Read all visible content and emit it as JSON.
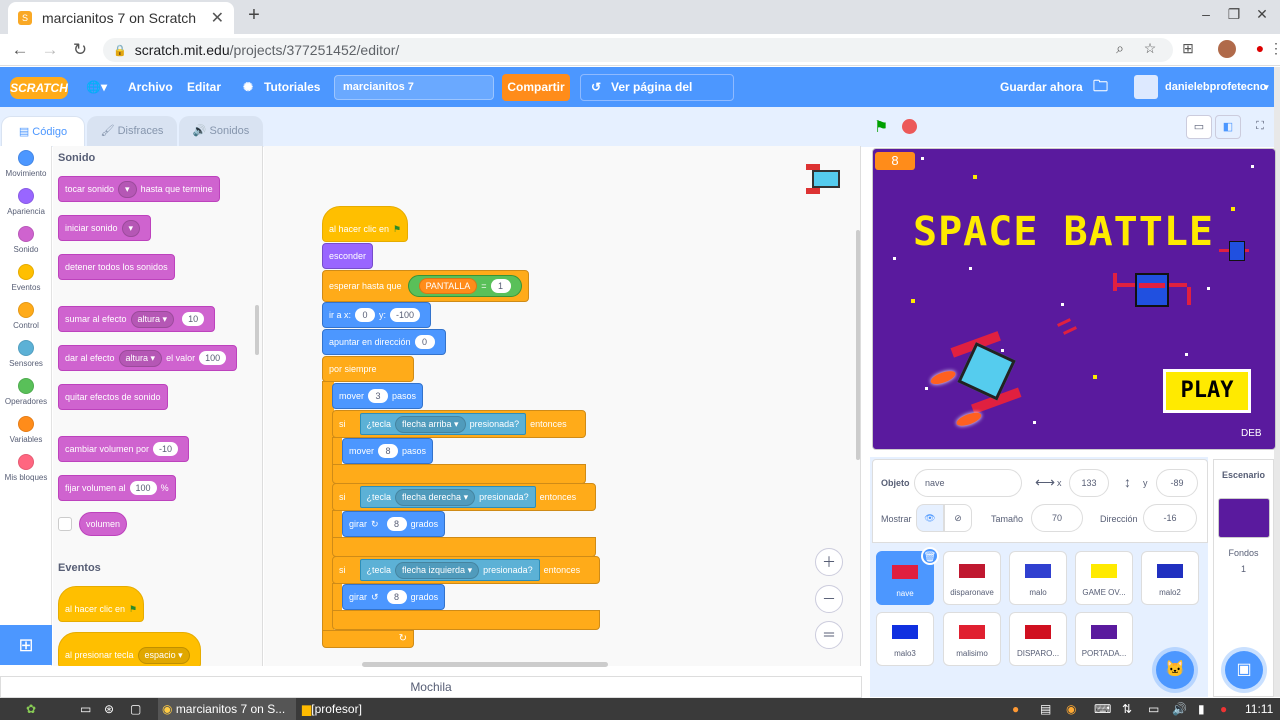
{
  "browser": {
    "tab_title": "marcianitos 7 on Scratch",
    "url_host": "scratch.mit.edu",
    "url_path": "/projects/377251452/editor/"
  },
  "menu": {
    "logo": "SCRATCH",
    "file": "Archivo",
    "edit": "Editar",
    "tutorials": "Tutoriales",
    "project_name": "marcianitos 7",
    "share": "Compartir",
    "project_page": "Ver página del proyecto",
    "save_now": "Guardar ahora",
    "username": "danielebprofetecno"
  },
  "tabs": {
    "code": "Código",
    "costumes": "Disfraces",
    "sounds": "Sonidos"
  },
  "categories": [
    {
      "label": "Movimiento",
      "color": "#4c97ff"
    },
    {
      "label": "Apariencia",
      "color": "#9966ff"
    },
    {
      "label": "Sonido",
      "color": "#cf63cf"
    },
    {
      "label": "Eventos",
      "color": "#ffbf00"
    },
    {
      "label": "Control",
      "color": "#ffab19"
    },
    {
      "label": "Sensores",
      "color": "#5cb1d6"
    },
    {
      "label": "Operadores",
      "color": "#59c059"
    },
    {
      "label": "Variables",
      "color": "#ff8c1a"
    },
    {
      "label": "Mis bloques",
      "color": "#ff6680"
    }
  ],
  "palette": {
    "sound_heading": "Sonido",
    "play_until_done": "tocar sonido",
    "until_done_suffix": "hasta que termine",
    "start_sound": "iniciar sonido",
    "stop_all": "detener todos los sonidos",
    "change_effect": "sumar al efecto",
    "effect_pitch": "altura",
    "change_effect_val": "10",
    "set_effect": "dar al efecto",
    "set_effect_dd": "altura",
    "set_effect_mid": "el valor",
    "set_effect_val": "100",
    "clear_effects": "quitar efectos de sonido",
    "change_volume": "cambiar volumen por",
    "change_volume_val": "-10",
    "set_volume": "fijar volumen al",
    "set_volume_val": "100",
    "set_volume_unit": "%",
    "volume_reporter": "volumen",
    "events_heading": "Eventos",
    "when_flag": "al hacer clic en",
    "when_key": "al presionar tecla",
    "when_key_dd": "espacio"
  },
  "script": {
    "when_flag": "al hacer clic en",
    "hide": "esconder",
    "wait_until": "esperar hasta que",
    "var_pantalla": "PANTALLA",
    "eq": "=",
    "eq_val": "1",
    "goto": "ir a x:",
    "goto_x": "0",
    "goto_y_label": "y:",
    "goto_y": "-100",
    "point_dir": "apuntar en dirección",
    "point_dir_val": "0",
    "forever": "por siempre",
    "move1": "mover",
    "move1_val": "3",
    "steps": "pasos",
    "if1": "si",
    "key_label": "¿tecla",
    "key1": "flecha arriba",
    "pressed": "presionada?",
    "then": "entonces",
    "move2": "mover",
    "move2_val": "8",
    "if2": "si",
    "key2": "flecha derecha",
    "turn_right": "girar",
    "turn_right_val": "8",
    "degrees": "grados",
    "if3": "si",
    "key3": "flecha izquierda",
    "turn_left": "girar",
    "turn_left_val": "8"
  },
  "backpack": "Mochila",
  "stage": {
    "score": "8",
    "title": "SPACE BATTLE",
    "play": "PLAY",
    "credit": "DEB"
  },
  "sprite_info": {
    "sprite_label": "Objeto",
    "sprite_name": "nave",
    "x_label": "x",
    "x": "133",
    "y_label": "y",
    "y": "-89",
    "show_label": "Mostrar",
    "size_label": "Tamaño",
    "size": "70",
    "direction_label": "Dirección",
    "direction": "-16"
  },
  "sprites": [
    {
      "name": "nave",
      "color": "#e02040"
    },
    {
      "name": "disparonave",
      "color": "#c01830"
    },
    {
      "name": "malo",
      "color": "#3040d0"
    },
    {
      "name": "GAME OV...",
      "color": "#ffea00"
    },
    {
      "name": "malo2",
      "color": "#2030c0"
    },
    {
      "name": "malo3",
      "color": "#1030e0"
    },
    {
      "name": "malisimo",
      "color": "#e02030"
    },
    {
      "name": "DISPARO...",
      "color": "#d01020"
    },
    {
      "name": "PORTADA...",
      "color": "#5a1a9e"
    }
  ],
  "backdrop": {
    "heading": "Escenario",
    "label": "Fondos",
    "count": "1"
  },
  "taskbar": {
    "chrome_item": "marcianitos 7 on S...",
    "folder_item": "[profesor]",
    "clock": "11:11"
  }
}
